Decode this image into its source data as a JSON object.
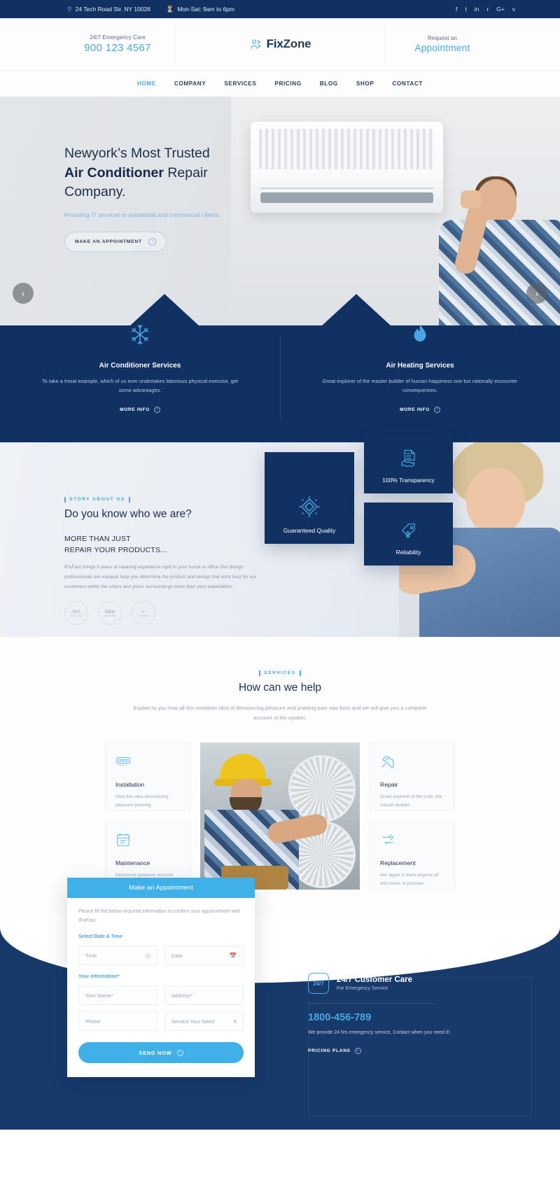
{
  "topbar": {
    "address": "24 Tech Road Str. NY 10026",
    "hours": "Mon-Sat: 9am to 6pm",
    "address_icon": "location-pin-icon",
    "hours_icon": "clock-icon",
    "social": [
      "f",
      "t",
      "in",
      "r",
      "G+",
      "v"
    ]
  },
  "header": {
    "emergency_label": "24/7 Emergency Care",
    "emergency_phone": "900 123 4567",
    "logo_text_1": "Fix",
    "logo_text_2": "Zone",
    "request_label": "Request an",
    "request_link": "Appointment"
  },
  "nav": {
    "items": [
      {
        "label": "HOME",
        "active": true
      },
      {
        "label": "COMPANY",
        "active": false
      },
      {
        "label": "SERVICES",
        "active": false
      },
      {
        "label": "PRICING",
        "active": false
      },
      {
        "label": "BLOG",
        "active": false
      },
      {
        "label": "SHOP",
        "active": false
      },
      {
        "label": "CONTACT",
        "active": false
      }
    ]
  },
  "hero": {
    "line1": "Newyork’s Most Trusted",
    "line2_bold": "Air Conditioner",
    "line2_rest": " Repair",
    "line3": "Company.",
    "subtitle": "Providing IT services to residential and commercial clients.",
    "button": "MAKE AN APPOINTMENT",
    "prev_icon": "chevron-left-icon",
    "next_icon": "chevron-right-icon"
  },
  "strip": {
    "cards": [
      {
        "icon": "snowflake-icon",
        "title": "Air Conditioner Services",
        "text": "To take a trivial example, which of us ever undertakes laborious physical exercise, get some advantages.",
        "more": "MORE INFO"
      },
      {
        "icon": "flame-icon",
        "title": "Air Heating Services",
        "text": "Great explorer of the master builder of human happiness one but rationally encounter consequences.",
        "more": "MORE INFO"
      }
    ]
  },
  "about": {
    "eyebrow": "STORY ABOUT US",
    "heading": "Do you know who we are?",
    "sub1": "MORE THAN JUST",
    "sub2": "REPAIR YOUR PRODUCTS...",
    "paragraph": "iFixFast brings 9 years of reparing experience right to your home or office Our design professionals are equippe help you determine the product and design that work best for our customers within the colors and yours surroundings more than your expectation.",
    "badges": [
      {
        "label": "ISO",
        "sub": "9001:2015"
      },
      {
        "label": "BBB",
        "sub": "Accredited"
      },
      {
        "label": "✓",
        "sub": "Certified"
      }
    ],
    "features": [
      {
        "label": "Guaranteed Quality",
        "icon": "diamond-sparkle-icon"
      },
      {
        "label": "100% Transparency",
        "icon": "document-handshake-icon"
      },
      {
        "label": "Reliability",
        "icon": "price-tag-icon"
      }
    ]
  },
  "services": {
    "eyebrow": "SERVICES",
    "heading": "How can we help",
    "paragraph": "Explain to you how all this mistaken idea of denouncing pleasure and praising pain was born and we will give you a complete account of the system.",
    "cards": [
      {
        "icon": "ac-unit-icon",
        "title": "Installation",
        "text": "How this idea denouncing pleasure praising."
      },
      {
        "icon": "calendar-maintenance-icon",
        "title": "Maintenance",
        "text": "Denounce pleasure account was born & complete."
      },
      {
        "icon": "tools-cross-icon",
        "title": "Repair",
        "text": "Great explorer of the truth, the master-builder."
      },
      {
        "icon": "replace-arrows-icon",
        "title": "Replacement",
        "text": "Nor again is there anyone all who loves or pursues."
      }
    ]
  },
  "appointment": {
    "title": "Make an Appointment",
    "note": "Please fill the below required information to confirm your appoinement with iFixFast.",
    "section_label": "Select Date & Time",
    "info_label": "Your Information*",
    "fields": [
      {
        "placeholder": "Time",
        "icon": "clock-icon"
      },
      {
        "placeholder": "Date",
        "icon": "calendar-icon"
      },
      {
        "placeholder": "Your Name*",
        "icon": ""
      },
      {
        "placeholder": "Address*",
        "icon": ""
      },
      {
        "placeholder": "Phone",
        "icon": ""
      },
      {
        "placeholder": "Service Your Need",
        "icon": "chevron-down-icon"
      }
    ],
    "submit": "SEND NOW"
  },
  "care": {
    "badge": "24/7",
    "title": "24/7 Customer Care",
    "subtitle": "For Emergency Service",
    "phone": "1800-456-789",
    "paragraph": "We provide 24 hrs emergency service, Contact when you need it!.",
    "link": "PRICING PLANS"
  }
}
